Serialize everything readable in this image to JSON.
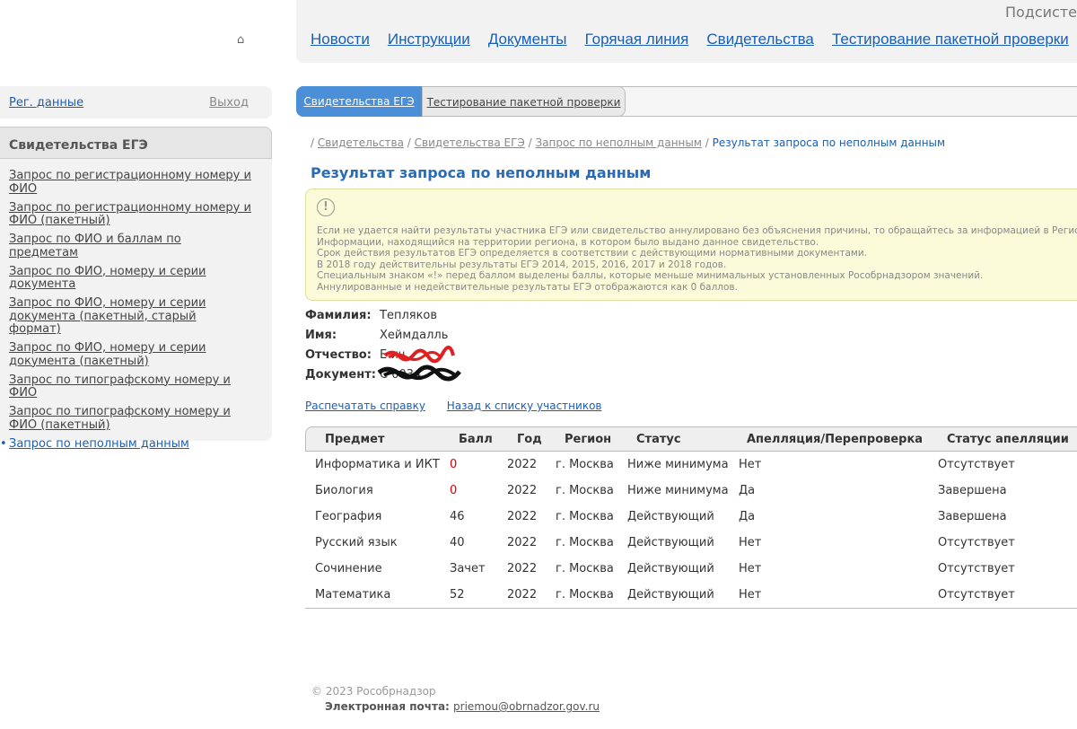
{
  "header": {
    "subsystem": "Подсисте",
    "home_icon": "home-icon",
    "nav": [
      "Новости",
      "Инструкции",
      "Документы",
      "Горячая линия",
      "Свидетельства",
      "Тестирование пакетной проверки"
    ]
  },
  "user": {
    "reg_data": "Рег. данные",
    "logout": "Выход"
  },
  "sidebar": {
    "title": "Свидетельства ЕГЭ",
    "items": [
      "Запрос по регистрационному номеру и ФИО",
      "Запрос по регистрационному номеру и ФИО (пакетный)",
      "Запрос по ФИО и баллам по предметам",
      "Запрос по ФИО, номеру и серии документа",
      "Запрос по ФИО, номеру и серии документа (пакетный, старый формат)",
      "Запрос по ФИО, номеру и серии документа (пакетный)",
      "Запрос по типографскому номеру и ФИО",
      "Запрос по типографскому номеру и ФИО (пакетный)",
      "Запрос по неполным данным"
    ],
    "active_index": 8
  },
  "tabs": [
    "Свидетельства ЕГЭ",
    "Тестирование пакетной проверки"
  ],
  "breadcrumb": {
    "sep": "/",
    "items": [
      "Свидетельства",
      "Свидетельства ЕГЭ",
      "Запрос по неполным данным"
    ],
    "current": "Результат запроса по неполным данным"
  },
  "page_title": "Результат запроса по неполным данным",
  "notice": {
    "icon": "!",
    "lines": [
      "Если не удается найти результаты участника ЕГЭ или свидетельство аннулировано без объяснения причины, то обращайтесь за информацией в Регион",
      "Информации, находящийся на территории региона, в котором было выдано данное свидетельство.",
      "Срок действия результатов ЕГЭ определяется в соответствии с действующими нормативными документами.",
      "В 2018 году действительны результаты ЕГЭ 2014, 2015, 2016, 2017 и 2018 годов.",
      "Специальным знаком «!» перед баллом выделены баллы, которые меньше минимальных установленных Рособрнадзором значений.",
      "Аннулированные и недействительные результаты ЕГЭ отображаются как 0 баллов."
    ]
  },
  "person": {
    "surname_label": "Фамилия:",
    "surname": "Тепляков",
    "name_label": "Имя:",
    "name": "Хеймдалль",
    "patronymic_label": "Отчество:",
    "patronymic": "Е      ич",
    "document_label": "Документ:",
    "document": "С          0034"
  },
  "actions": {
    "print": "Распечатать справку",
    "back": "Назад к списку участников"
  },
  "table": {
    "headers": [
      "Предмет",
      "Балл",
      "Год",
      "Регион",
      "Статус",
      "Апелляция/Перепроверка",
      "Статус апелляции"
    ],
    "rows": [
      [
        "Информатика и ИКТ",
        "0",
        "2022",
        "г. Москва",
        "Ниже минимума",
        "Нет",
        "Отсутствует"
      ],
      [
        "Биология",
        "0",
        "2022",
        "г. Москва",
        "Ниже минимума",
        "Да",
        "Завершена"
      ],
      [
        "География",
        "46",
        "2022",
        "г. Москва",
        "Действующий",
        "Да",
        "Завершена"
      ],
      [
        "Русский язык",
        "40",
        "2022",
        "г. Москва",
        "Действующий",
        "Нет",
        "Отсутствует"
      ],
      [
        "Сочинение",
        "Зачет",
        "2022",
        "г. Москва",
        "Действующий",
        "Нет",
        "Отсутствует"
      ],
      [
        "Математика",
        "52",
        "2022",
        "г. Москва",
        "Действующий",
        "Нет",
        "Отсутствует"
      ]
    ],
    "highlight_color": "#d40000"
  },
  "footer": {
    "copyright": "© 2023 Рособрнадзор",
    "email_label": "Электронная почта:",
    "email": "priemou@obrnadzor.gov.ru"
  }
}
